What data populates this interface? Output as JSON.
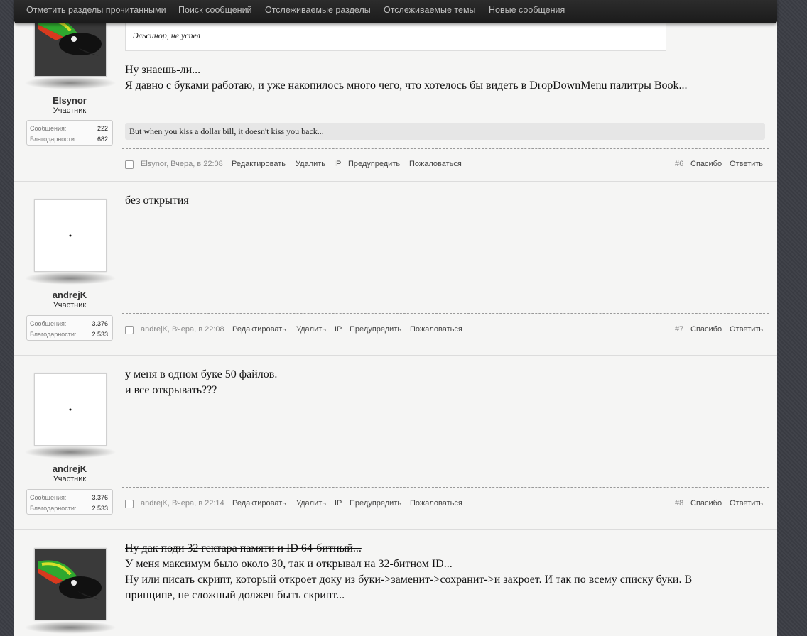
{
  "nav": {
    "items": [
      "Отметить разделы прочитанными",
      "Поиск сообщений",
      "Отслеживаемые разделы",
      "Отслеживаемые темы",
      "Новые сообщения"
    ]
  },
  "actions": {
    "edit": "Редактировать",
    "delete": "Удалить",
    "ip": "IP",
    "warn": "Предупредить",
    "report": "Пожаловаться",
    "thanks": "Спасибо",
    "reply": "Ответить"
  },
  "posts": [
    {
      "user": {
        "name": "Elsynor",
        "role": "Участник",
        "messages_label": "Сообщения:",
        "messages": "222",
        "thanks_label": "Благодарности:",
        "thanks": "682"
      },
      "quote": "Эльсинор, не успел",
      "lines": [
        "Ну знаешь-ли...",
        "Я давно с буками работаю, и уже накопилось много чего, что хотелось бы видеть в DropDownMenu палитры Book..."
      ],
      "signature": "But when you kiss a dollar bill, it doesn't kiss you back...",
      "meta": "Elsynor, Вчера, в 22:08",
      "number": "#6"
    },
    {
      "user": {
        "name": "andrejK",
        "role": "Участник",
        "messages_label": "Сообщения:",
        "messages": "3.376",
        "thanks_label": "Благодарности:",
        "thanks": "2.533"
      },
      "lines": [
        "без открытия"
      ],
      "meta": "andrejK, Вчера, в 22:08",
      "number": "#7"
    },
    {
      "user": {
        "name": "andrejK",
        "role": "Участник",
        "messages_label": "Сообщения:",
        "messages": "3.376",
        "thanks_label": "Благодарности:",
        "thanks": "2.533"
      },
      "lines": [
        "у меня в одном буке 50 файлов.",
        "и все открывать???"
      ],
      "meta": "andrejK, Вчера, в 22:14",
      "number": "#8"
    },
    {
      "lines_strike": "Ну дак поди 32 гектара памяти и ID 64-битный...",
      "lines": [
        "У меня максимум было около 30, так и открывал на 32-битном ID...",
        "Ну или писать скрипт, который откроет доку из буки->заменит->сохранит->и закроет. И так по всему списку буки. В",
        "принципе, не сложный должен быть скрипт..."
      ]
    }
  ]
}
